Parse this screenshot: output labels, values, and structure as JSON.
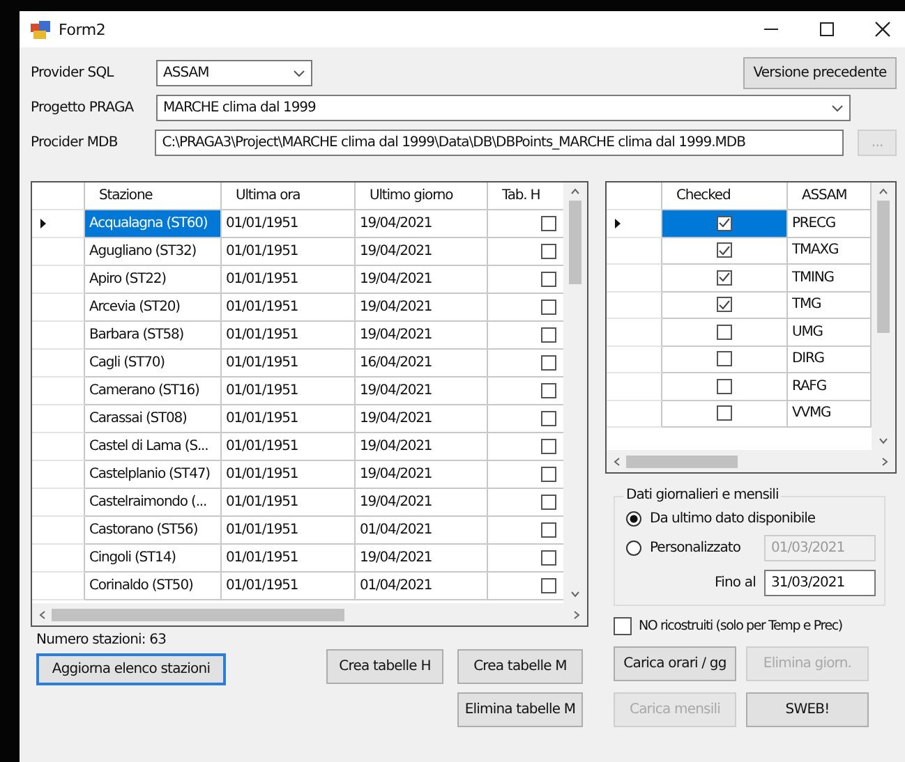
{
  "window": {
    "title": "Form2"
  },
  "provider_sql": {
    "label": "Provider SQL",
    "value": "ASSAM"
  },
  "version_button": {
    "label": "Versione precedente"
  },
  "progetto_praga": {
    "label": "Progetto PRAGA",
    "value": "MARCHE clima dal 1999"
  },
  "procider_mdb": {
    "label": "Procider MDB",
    "value": "C:\\PRAGA3\\Project\\MARCHE clima dal 1999\\Data\\DB\\DBPoints_MARCHE clima dal 1999.MDB",
    "browse": "...",
    "browse_disabled": true
  },
  "stations_grid": {
    "columns": [
      "Stazione",
      "Ultima ora",
      "Ultimo giorno",
      "Tab. H"
    ],
    "rows": [
      {
        "stazione": "Acqualagna (ST60)",
        "ultima_ora": "01/01/1951",
        "ultimo_giorno": "19/04/2021",
        "tab_h": false,
        "selected": true
      },
      {
        "stazione": "Agugliano (ST32)",
        "ultima_ora": "01/01/1951",
        "ultimo_giorno": "19/04/2021",
        "tab_h": false,
        "selected": false
      },
      {
        "stazione": "Apiro (ST22)",
        "ultima_ora": "01/01/1951",
        "ultimo_giorno": "19/04/2021",
        "tab_h": false,
        "selected": false
      },
      {
        "stazione": "Arcevia (ST20)",
        "ultima_ora": "01/01/1951",
        "ultimo_giorno": "19/04/2021",
        "tab_h": false,
        "selected": false
      },
      {
        "stazione": "Barbara (ST58)",
        "ultima_ora": "01/01/1951",
        "ultimo_giorno": "19/04/2021",
        "tab_h": false,
        "selected": false
      },
      {
        "stazione": "Cagli (ST70)",
        "ultima_ora": "01/01/1951",
        "ultimo_giorno": "16/04/2021",
        "tab_h": false,
        "selected": false
      },
      {
        "stazione": "Camerano (ST16)",
        "ultima_ora": "01/01/1951",
        "ultimo_giorno": "19/04/2021",
        "tab_h": false,
        "selected": false
      },
      {
        "stazione": "Carassai (ST08)",
        "ultima_ora": "01/01/1951",
        "ultimo_giorno": "19/04/2021",
        "tab_h": false,
        "selected": false
      },
      {
        "stazione": "Castel di Lama (S...",
        "ultima_ora": "01/01/1951",
        "ultimo_giorno": "19/04/2021",
        "tab_h": false,
        "selected": false
      },
      {
        "stazione": "Castelplanio (ST47)",
        "ultima_ora": "01/01/1951",
        "ultimo_giorno": "19/04/2021",
        "tab_h": false,
        "selected": false
      },
      {
        "stazione": "Castelraimondo (...",
        "ultima_ora": "01/01/1951",
        "ultimo_giorno": "19/04/2021",
        "tab_h": false,
        "selected": false
      },
      {
        "stazione": "Castorano (ST56)",
        "ultima_ora": "01/01/1951",
        "ultimo_giorno": "01/04/2021",
        "tab_h": false,
        "selected": false
      },
      {
        "stazione": "Cingoli (ST14)",
        "ultima_ora": "01/01/1951",
        "ultimo_giorno": "19/04/2021",
        "tab_h": false,
        "selected": false
      },
      {
        "stazione": "Corinaldo (ST50)",
        "ultima_ora": "01/01/1951",
        "ultimo_giorno": "01/04/2021",
        "tab_h": false,
        "selected": false
      }
    ]
  },
  "variables_grid": {
    "columns": [
      "Checked",
      "ASSAM"
    ],
    "rows": [
      {
        "checked": true,
        "name": "PRECG",
        "selected": true
      },
      {
        "checked": true,
        "name": "TMAXG",
        "selected": false
      },
      {
        "checked": true,
        "name": "TMING",
        "selected": false
      },
      {
        "checked": true,
        "name": "TMG",
        "selected": false
      },
      {
        "checked": false,
        "name": "UMG",
        "selected": false
      },
      {
        "checked": false,
        "name": "DIRG",
        "selected": false
      },
      {
        "checked": false,
        "name": "RAFG",
        "selected": false
      },
      {
        "checked": false,
        "name": "VVMG",
        "selected": false
      }
    ]
  },
  "station_count": "Numero stazioni: 63",
  "station_buttons": [
    {
      "label": "Aggiorna elenco stazioni",
      "focused": true
    },
    {
      "label": "Crea tabelle H",
      "focused": false
    },
    {
      "label": "Crea tabelle M",
      "focused": false
    },
    {
      "label": "Elimina tabelle M",
      "focused": false
    }
  ],
  "daily_group": {
    "title": "Dati giornalieri e mensili",
    "radios": [
      {
        "label": "Da ultimo dato disponibile",
        "selected": true
      },
      {
        "label": "Personalizzato",
        "selected": false
      }
    ],
    "from_date": {
      "value": "01/03/2021",
      "disabled": true
    },
    "to_date": {
      "label": "Fino al",
      "value": "31/03/2021"
    }
  },
  "no_rebuilt": {
    "label": "NO ricostruiti (solo per Temp e Prec)",
    "checked": false
  },
  "load_buttons": [
    {
      "label": "Carica orari / gg",
      "disabled": false
    },
    {
      "label": "Elimina giorn.",
      "disabled": true
    },
    {
      "label": "Carica mensili",
      "disabled": true
    },
    {
      "label": "SWEB!",
      "disabled": false
    }
  ]
}
